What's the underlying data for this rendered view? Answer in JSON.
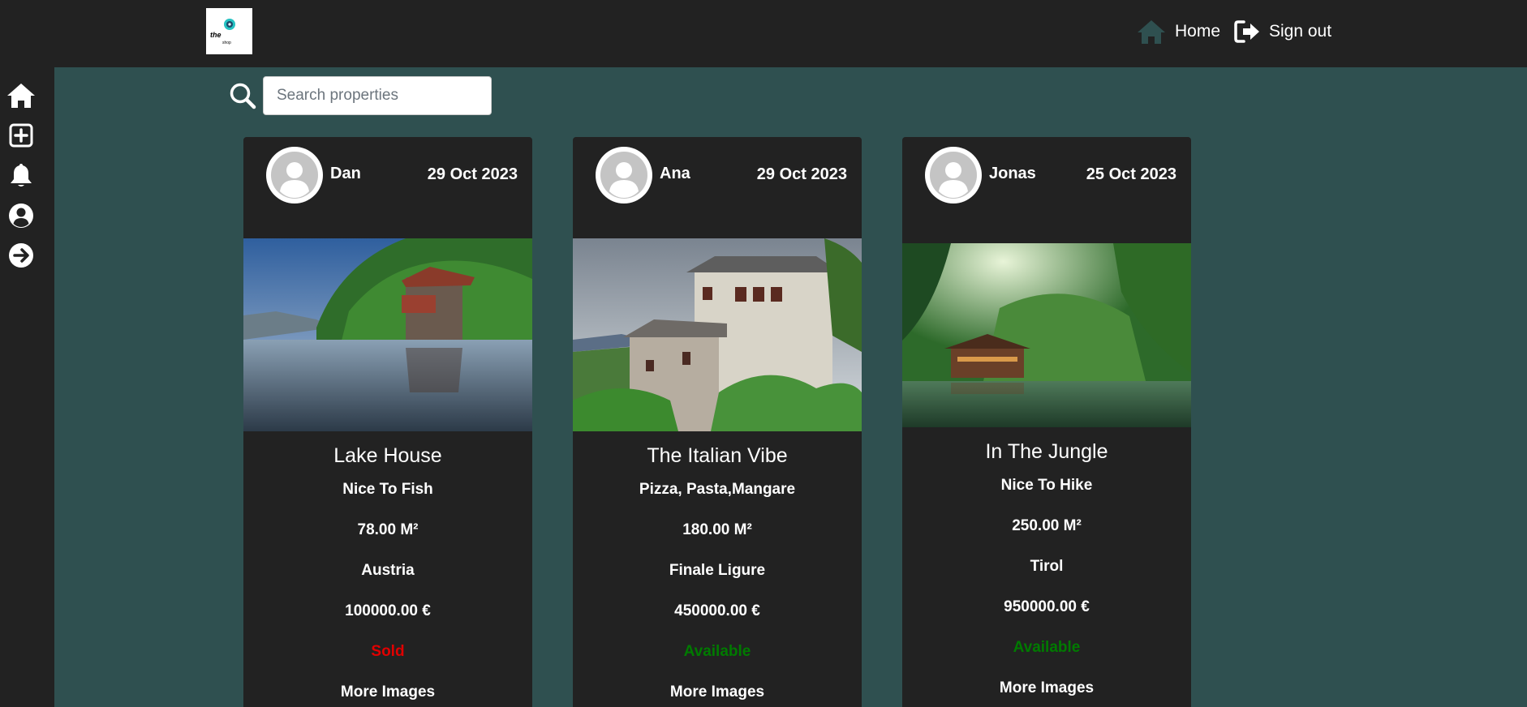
{
  "header": {
    "logo_text": "the",
    "logo_subtext": "shop",
    "nav": [
      {
        "label": "Home",
        "icon": "house-icon"
      },
      {
        "label": "Sign out",
        "icon": "sign-out-icon"
      }
    ]
  },
  "sidebar": {
    "items": [
      {
        "icon": "home-icon"
      },
      {
        "icon": "add-square-icon"
      },
      {
        "icon": "bell-icon"
      },
      {
        "icon": "user-circle-icon"
      },
      {
        "icon": "arrow-right-circle-icon"
      }
    ]
  },
  "search": {
    "placeholder": "Search properties",
    "value": ""
  },
  "listings": [
    {
      "author": "Dan",
      "date": "29 Oct 2023",
      "image": "lake-house-photo",
      "title": "Lake House",
      "description": "Nice To Fish",
      "area": "78.00 M²",
      "location": "Austria",
      "price": "100000.00 €",
      "status": "Sold",
      "more": "More Images"
    },
    {
      "author": "Ana",
      "date": "29 Oct 2023",
      "image": "italian-villa-photo",
      "title": "The Italian Vibe",
      "description": "Pizza, Pasta,Mangare",
      "area": "180.00 M²",
      "location": "Finale Ligure",
      "price": "450000.00 €",
      "status": "Available",
      "more": "More Images"
    },
    {
      "author": "Jonas",
      "date": "25 Oct 2023",
      "image": "jungle-chalet-photo",
      "title": "In The Jungle",
      "description": "Nice To Hike",
      "area": "250.00 M²",
      "location": "Tirol",
      "price": "950000.00 €",
      "status": "Available",
      "more": "More Images"
    }
  ],
  "colors": {
    "page_bg": "#2f5050",
    "bar_bg": "#222222",
    "sold": "#e00000",
    "available": "#007a00"
  }
}
